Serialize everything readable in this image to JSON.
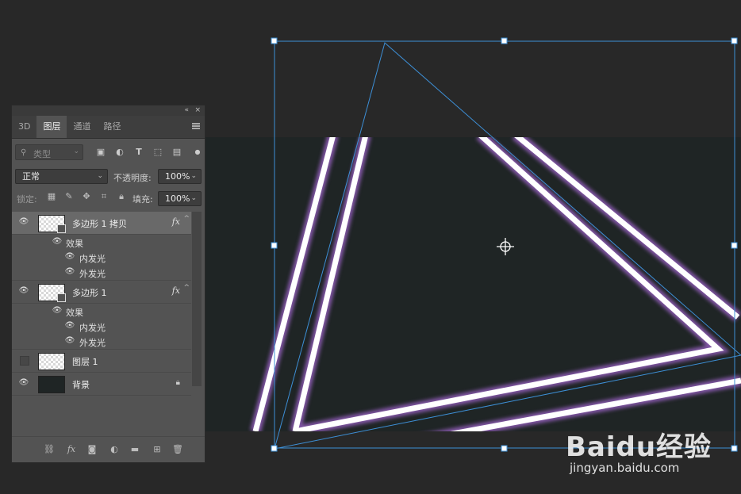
{
  "panel": {
    "header_controls": {
      "collapse": "«",
      "close": "×"
    },
    "tabs": [
      {
        "label": "3D",
        "active": false
      },
      {
        "label": "图层",
        "active": true
      },
      {
        "label": "通道",
        "active": false
      },
      {
        "label": "路径",
        "active": false
      }
    ],
    "filter": {
      "placeholder": "类型",
      "icons": [
        "image-filter-icon",
        "adjustment-filter-icon",
        "type-filter-icon",
        "shape-filter-icon",
        "smart-object-filter-icon"
      ]
    },
    "blend_mode": "正常",
    "opacity_label": "不透明度:",
    "opacity_value": "100%",
    "lock_label": "锁定:",
    "fill_label": "填充:",
    "fill_value": "100%",
    "layers": [
      {
        "name": "多边形 1 拷贝",
        "selected": true,
        "visible": true,
        "fx": "fx",
        "effects_label": "效果",
        "effects": [
          "内发光",
          "外发光"
        ]
      },
      {
        "name": "多边形 1",
        "selected": false,
        "visible": true,
        "fx": "fx",
        "effects_label": "效果",
        "effects": [
          "内发光",
          "外发光"
        ]
      },
      {
        "name": "图层 1",
        "selected": false,
        "visible": false
      },
      {
        "name": "背景",
        "selected": false,
        "visible": true,
        "locked": true
      }
    ]
  },
  "watermark": {
    "brand": "Baidu经验",
    "url": "jingyan.baidu.com"
  },
  "colors": {
    "canvas_bg": "#1f2525",
    "workspace": "#282828",
    "panel": "#535353",
    "selection": "#3d8fd6",
    "glow": "#a070c8"
  }
}
